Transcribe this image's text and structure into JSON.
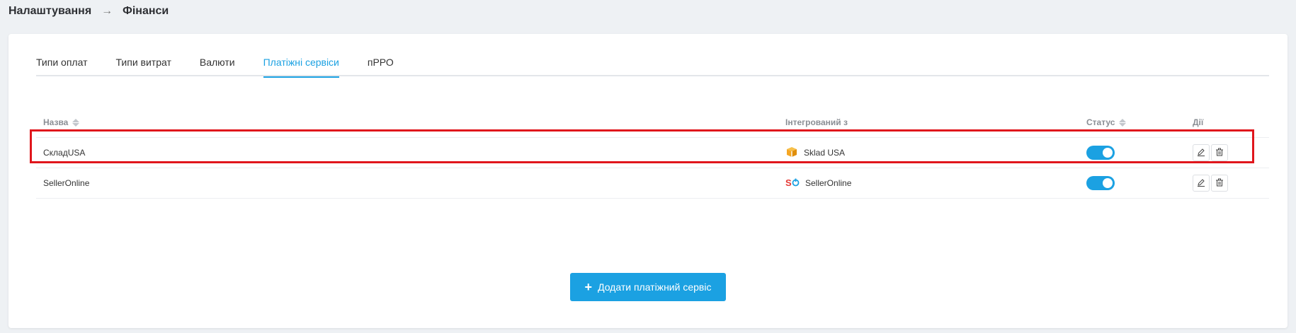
{
  "breadcrumb": {
    "parent": "Налаштування",
    "separator": "→",
    "current": "Фінанси"
  },
  "tabs": [
    {
      "label": "Типи оплат",
      "active": false
    },
    {
      "label": "Типи витрат",
      "active": false
    },
    {
      "label": "Валюти",
      "active": false
    },
    {
      "label": "Платіжні сервіси",
      "active": true
    },
    {
      "label": "пРРО",
      "active": false
    }
  ],
  "table": {
    "headers": {
      "name": "Назва",
      "integrated": "Інтегрований з",
      "status": "Статус",
      "actions": "Дії"
    },
    "rows": [
      {
        "name": "СкладUSA",
        "integration": "Sklad USA",
        "integration_icon": "box-icon",
        "status": true
      },
      {
        "name": "SellerOnline",
        "integration": "SellerOnline",
        "integration_icon": "selleronline-logo-icon",
        "status": true
      }
    ]
  },
  "add_button": {
    "label": "Додати платіжний сервіс"
  },
  "colors": {
    "accent": "#1ba1e2",
    "highlight": "#e0161c",
    "box_icon": "#f5a623",
    "selleronline_s": "#e53935"
  }
}
